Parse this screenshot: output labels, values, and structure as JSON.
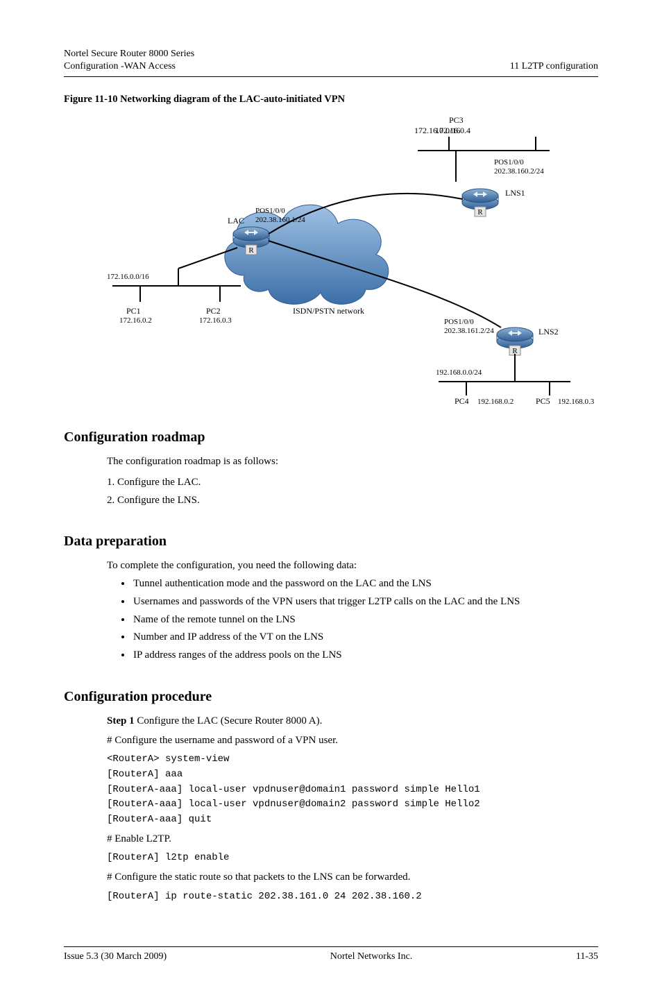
{
  "header": {
    "left_line1": "Nortel Secure Router 8000 Series",
    "left_line2": "Configuration -WAN Access",
    "right_line1": "11 L2TP configuration"
  },
  "figure": {
    "caption": "Figure 11-10 Networking diagram of the LAC-auto-initiated VPN",
    "labels": {
      "pc1": "PC1",
      "pc2": "PC2",
      "pc3": "PC3",
      "pc4": "PC4",
      "pc5": "PC5",
      "lac": "LAC",
      "lns1": "LNS1",
      "lns2": "LNS2",
      "network": "ISDN/PSTN network"
    },
    "ips": {
      "net1_gw": "172.16.0.0/16",
      "pc1": "172.16.0.2",
      "pc2": "172.16.0.3",
      "lac_pos1": "POS1/0/0",
      "lac_pos1_ip": "202.38.160.1/24",
      "lns1_pos1": "POS1/0/0",
      "lns1_pos1_ip": "202.38.160.2/24",
      "pc3_ip": "172.16.0.4",
      "pc4_ip": "192.168.0.2",
      "pc5_ip": "192.168.0.3",
      "net2_gw": "192.168.0.0/24",
      "lns2_pos1": "POS1/0/0",
      "lns2_pos1_ip": "202.38.161.2/24"
    }
  },
  "roadmap": {
    "heading": "Configuration roadmap",
    "intro": "The configuration roadmap is as follows:",
    "steps": {
      "1": "1.    Configure the LAC.",
      "2": "2.    Configure the LNS."
    }
  },
  "dataprep": {
    "heading": "Data preparation",
    "intro": "To complete the configuration, you need the following data:",
    "items": {
      "0": "Tunnel authentication mode and the password on the LAC and the LNS",
      "1": "Usernames and passwords of the VPN users that trigger L2TP calls on the LAC and the LNS",
      "2": "Name of the remote tunnel on the LNS",
      "3": "Number and IP address of the VT on the LNS",
      "4": "IP address ranges of the address pools on the LNS"
    }
  },
  "procedure": {
    "heading": "Configuration procedure",
    "step1_label": "Step 1",
    "step1_text": " Configure the LAC (Secure Router 8000 A).",
    "step1_sub": "# Configure the username and password of a VPN user.",
    "code1": "<RouterA> system-view\n[RouterA] aaa\n[RouterA-aaa] local-user vpdnuser@domain1 password simple Hello1\n[RouterA-aaa] local-user vpdnuser@domain2 password simple Hello2\n[RouterA-aaa] quit\n",
    "step1_sub2": "# Enable L2TP.",
    "code2": "[RouterA] l2tp enable\n",
    "step1_sub3": "# Configure the static route so that packets to the LNS can be forwarded.",
    "code3": "[RouterA] ip route-static 202.38.161.0 24 202.38.160.2"
  },
  "footer": {
    "left": "Nortel Networks Inc.",
    "right": "11-35",
    "issue": "Issue 5.3 (30 March 2009)"
  }
}
